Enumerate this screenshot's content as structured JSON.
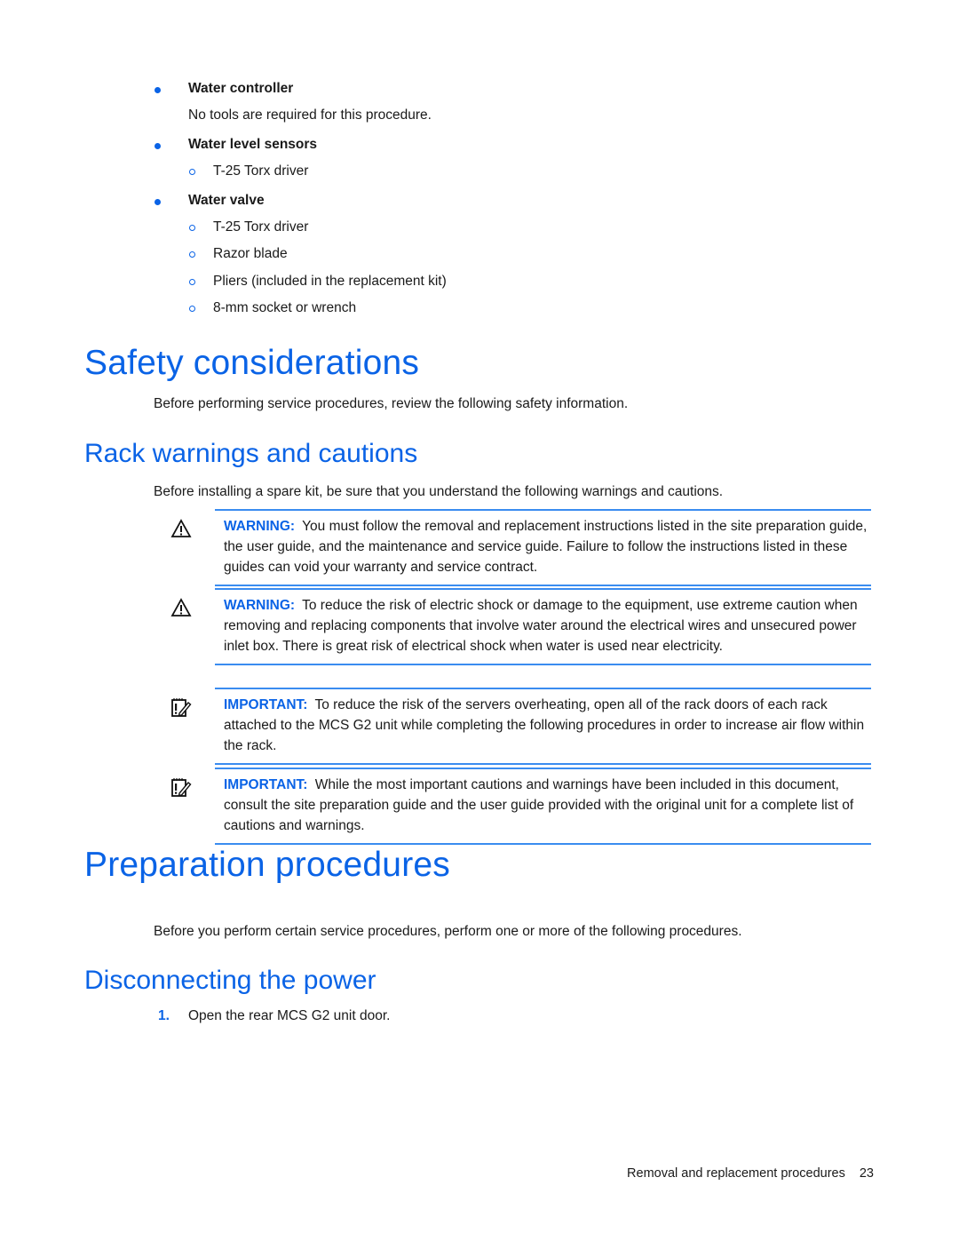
{
  "tools_list": [
    {
      "title": "Water controller",
      "note": "No tools are required for this procedure.",
      "items": []
    },
    {
      "title": "Water level sensors",
      "note": null,
      "items": [
        "T-25 Torx driver"
      ]
    },
    {
      "title": "Water valve",
      "note": null,
      "items": [
        "T-25 Torx driver",
        "Razor blade",
        "Pliers (included in the replacement kit)",
        "8-mm socket or wrench"
      ]
    }
  ],
  "safety": {
    "heading": "Safety considerations",
    "intro": "Before performing service procedures, review the following safety information."
  },
  "rack": {
    "heading": "Rack warnings and cautions",
    "intro": "Before installing a spare kit, be sure that you understand the following warnings and cautions.",
    "notes": [
      {
        "icon": "warning-triangle-icon",
        "label": "WARNING:",
        "text": "You must follow the removal and replacement instructions listed in the site preparation guide, the user guide, and the maintenance and service guide. Failure to follow the instructions listed in these guides can void your warranty and service contract."
      },
      {
        "icon": "warning-triangle-icon",
        "label": "WARNING:",
        "text": "To reduce the risk of electric shock or damage to the equipment, use extreme caution when removing and replacing components that involve water around the electrical wires and unsecured power inlet box. There is great risk of electrical shock when water is used near electricity."
      },
      {
        "icon": "important-notepad-icon",
        "label": "IMPORTANT:",
        "text": "To reduce the risk of the servers overheating, open all of the rack doors of each rack attached to the MCS G2 unit while completing the following procedures in order to increase air flow within the rack."
      },
      {
        "icon": "important-notepad-icon",
        "label": "IMPORTANT:",
        "text": "While the most important cautions and warnings have been included in this document, consult the site preparation guide and the user guide provided with the original unit for a complete list of cautions and warnings."
      }
    ]
  },
  "preparation": {
    "heading": "Preparation procedures",
    "intro": "Before you perform certain service procedures, perform one or more of the following procedures."
  },
  "disconnect": {
    "heading": "Disconnecting the power",
    "steps": [
      {
        "num": "1.",
        "text": "Open the rear MCS G2 unit door."
      }
    ]
  },
  "footer": {
    "section": "Removal and replacement procedures",
    "page": "23"
  },
  "colors": {
    "accent": "#0a63e6",
    "rule": "#3a8cf0"
  }
}
